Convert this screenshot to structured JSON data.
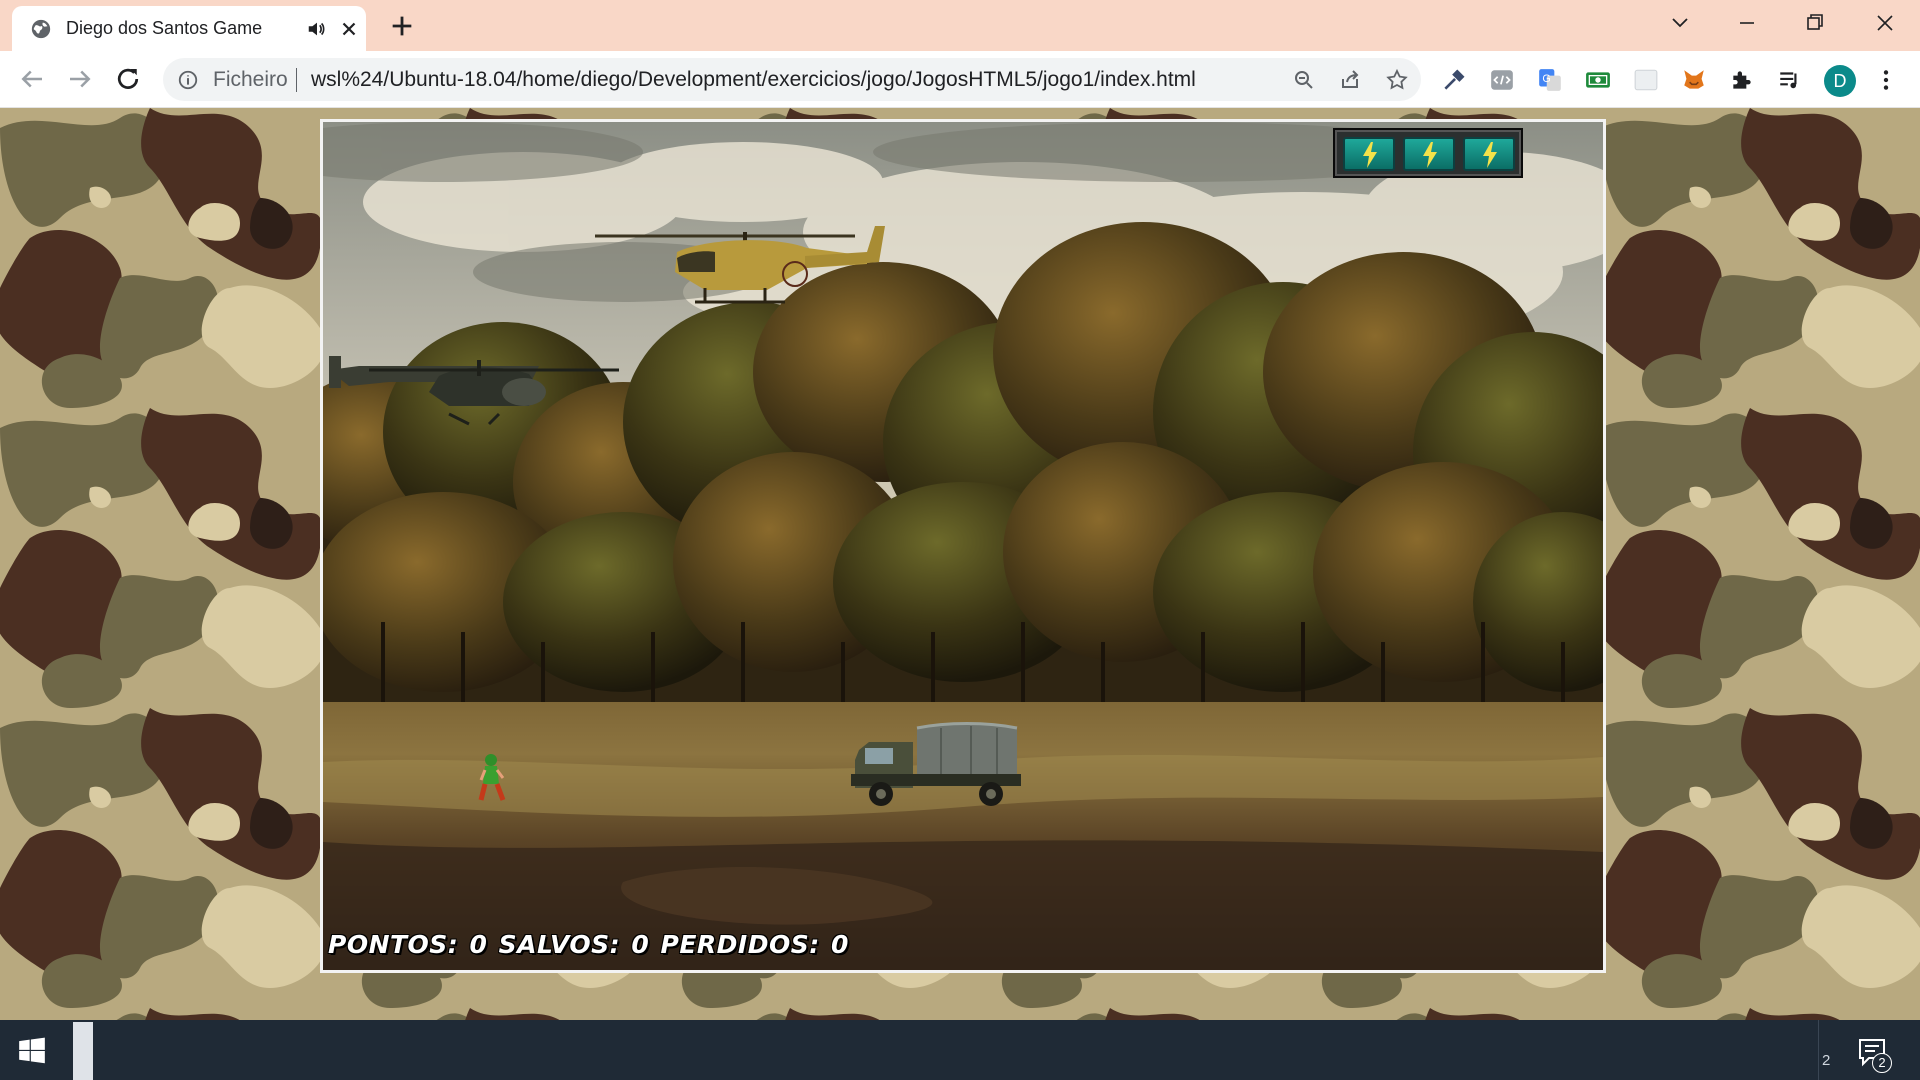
{
  "browser": {
    "tab": {
      "title": "Diego dos Santos Game",
      "favicon": "globe-icon",
      "audio_indicator": "speaker-icon"
    },
    "address_bar": {
      "scheme_label": "Ficheiro",
      "url": "wsl%24/Ubuntu-18.04/home/diego/Development/exercicios/jogo/JogosHTML5/jogo1/index.html"
    },
    "profile_initial": "D",
    "theme_color": "#f9d7c7"
  },
  "game": {
    "hud": {
      "points_label": "PONTOS:",
      "points_value": "0",
      "saved_label": "SALVOS:",
      "saved_value": "0",
      "lost_label": "PERDIDOS:",
      "lost_value": "0"
    },
    "energy_cells": 3,
    "sprites": [
      "enemy-helicopter",
      "player-helicopter",
      "friend-soldier",
      "enemy-truck"
    ]
  },
  "taskbar": {
    "tray_fragment": "2",
    "notification_count": "2"
  }
}
